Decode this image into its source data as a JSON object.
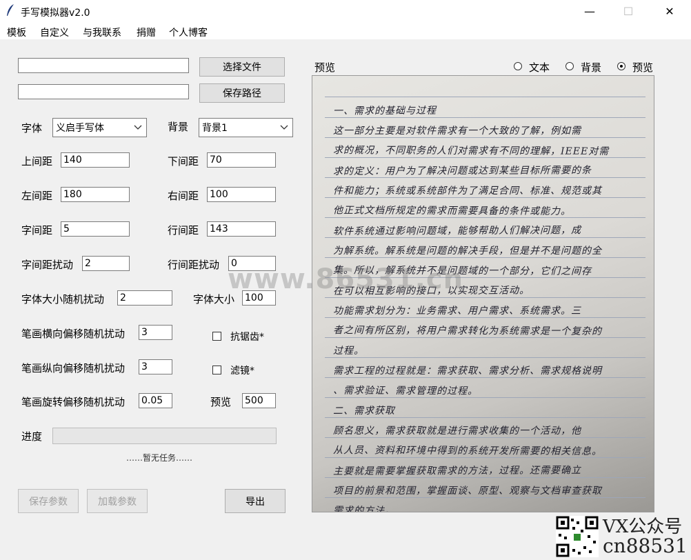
{
  "window": {
    "title": "手写模拟器v2.0",
    "minimize_glyph": "—",
    "maximize_glyph": "☐",
    "close_glyph": "✕"
  },
  "menu": [
    "模板",
    "自定义",
    "与我联系",
    "捐赠",
    "个人博客"
  ],
  "files": {
    "select_file_value": "",
    "select_file_button": "选择文件",
    "save_path_value": "",
    "save_path_button": "保存路径"
  },
  "font": {
    "label": "字体",
    "value": "义启手写体"
  },
  "background": {
    "label": "背景",
    "value": "背景1"
  },
  "params": {
    "top_margin": {
      "label": "上间距",
      "value": "140"
    },
    "bottom_margin": {
      "label": "下间距",
      "value": "70"
    },
    "left_margin": {
      "label": "左间距",
      "value": "180"
    },
    "right_margin": {
      "label": "右间距",
      "value": "100"
    },
    "char_spacing": {
      "label": "字间距",
      "value": "5"
    },
    "line_spacing": {
      "label": "行间距",
      "value": "143"
    },
    "char_spacing_jitter": {
      "label": "字间距扰动",
      "value": "2"
    },
    "line_spacing_jitter": {
      "label": "行间距扰动",
      "value": "0"
    },
    "font_size_jitter": {
      "label": "字体大小随机扰动",
      "value": "2"
    },
    "font_size": {
      "label": "字体大小",
      "value": "100"
    },
    "stroke_h_jitter": {
      "label": "笔画横向偏移随机扰动",
      "value": "3"
    },
    "stroke_v_jitter": {
      "label": "笔画纵向偏移随机扰动",
      "value": "3"
    },
    "stroke_rot_jitter": {
      "label": "笔画旋转偏移随机扰动",
      "value": "0.05"
    },
    "preview": {
      "label": "预览",
      "value": "500"
    }
  },
  "options": {
    "antialias": {
      "label": "抗锯齿*",
      "checked": false
    },
    "filter": {
      "label": "滤镜*",
      "checked": false
    }
  },
  "progress": {
    "label": "进度",
    "value": 0,
    "status": "……暂无任务……"
  },
  "buttons": {
    "save_params": "保存参数",
    "load_params": "加载参数",
    "export": "导出"
  },
  "preview_panel": {
    "label": "预览",
    "modes": [
      {
        "label": "文本",
        "selected": false
      },
      {
        "label": "背景",
        "selected": false
      },
      {
        "label": "预览",
        "selected": true
      }
    ],
    "lines": [
      "一、需求的基础与过程",
      "  这一部分主要是对软件需求有一个大致的了解，例如需",
      "求的概况，不同职务的人们对需求有不同的理解，IEEE对需",
      "求的定义：用户为了解决问题或达到某些目标所需要的条",
      "件和能力；系统或系统部件为了满足合同、标准、规范或其",
      "他正式文档所规定的需求而需要具备的条件或能力。",
      "  软件系统通过影响问题域，能够帮助人们解决问题，成",
      "为解系统。解系统是问题的解决手段，但是并不是问题的全",
      "集。所以，解系统并不是问题域的一个部分，它们之间存",
      "在可以相互影响的接口，以实现交互活动。",
      "  功能需求划分为：业务需求、用户需求、系统需求。三",
      "者之间有所区别，将用户需求转化为系统需求是一个复杂的",
      "过程。",
      "需求工程的过程就是：需求获取、需求分析、需求规格说明",
      "、需求验证、需求管理的过程。",
      "二、需求获取",
      "  顾名思义，需求获取就是进行需求收集的一个活动，他",
      "从人员、资料和环境中得到的系统开发所需要的相关信息。",
      "  主要就是需要掌握获取需求的方法，过程。还需要确立",
      "项目的前景和范围，掌握面谈、原型、观察与文档审查获取",
      "需求的方法。"
    ]
  },
  "watermark": "www.86531.cn",
  "footer": {
    "vx_line1": "VX公众号",
    "vx_line2": "cn88531"
  }
}
